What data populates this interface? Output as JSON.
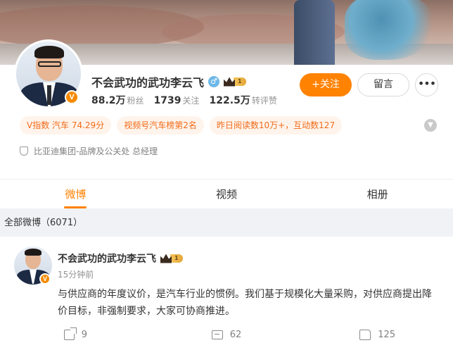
{
  "profile": {
    "name": "不会武功的武功李云飞",
    "gender_icon": "♂",
    "verified_badge": "V",
    "level": "1",
    "stats": [
      {
        "num": "88.2万",
        "label": "粉丝"
      },
      {
        "num": "1739",
        "label": "关注"
      },
      {
        "num": "122.5万",
        "label": "转评赞"
      }
    ],
    "follow_label": "+关注",
    "message_label": "留言",
    "more_label": "•••",
    "tags": [
      "V指数 汽车 74.29分",
      "视频号汽车榜第2名",
      "昨日阅读数10万+，互动数127"
    ],
    "toggle_icon": "chevron-down-icon",
    "verification": "比亚迪集团-品牌及公关处 总经理"
  },
  "tabs": [
    {
      "label": "微博",
      "active": true
    },
    {
      "label": "视频",
      "active": false
    },
    {
      "label": "相册",
      "active": false
    }
  ],
  "feed": {
    "header": "全部微博（6071）",
    "post": {
      "author": "不会武功的武功李云飞",
      "level": "1",
      "time": "15分钟前",
      "content": "与供应商的年度议价，是汽车行业的惯例。我们基于规模化大量采购，对供应商提出降价目标，非强制要求，大家可协商推进。",
      "shares": "9",
      "comments": "62",
      "likes": "125"
    }
  },
  "colors": {
    "accent": "#ff8200",
    "tag_bg": "#fff4ec",
    "tag_text": "#f26b18"
  }
}
